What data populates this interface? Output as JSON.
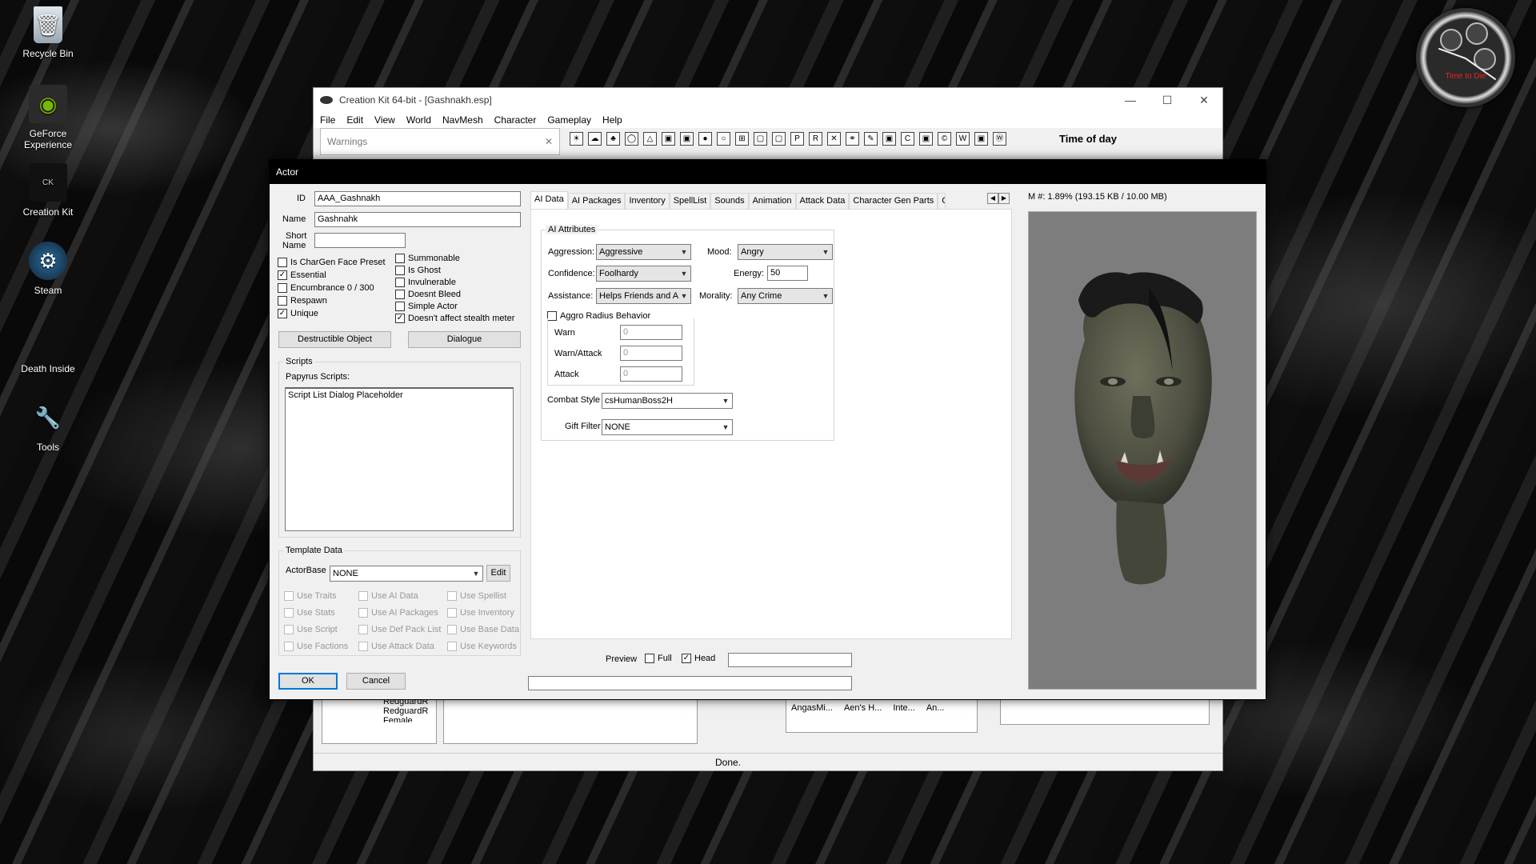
{
  "desktop": {
    "icons": [
      {
        "label": "Recycle Bin",
        "icon": "recycle-bin-icon"
      },
      {
        "label": "GeForce Experience",
        "icon": "geforce-icon"
      },
      {
        "label": "Creation Kit",
        "icon": "creation-kit-icon"
      },
      {
        "label": "Steam",
        "icon": "steam-icon"
      },
      {
        "label": "Death Inside",
        "icon": "folder-icon"
      },
      {
        "label": "Tools",
        "icon": "tools-icon"
      }
    ],
    "clock_label": "Time to Die"
  },
  "main_window": {
    "title": "Creation Kit 64-bit - [Gashnakh.esp]",
    "menu": [
      "File",
      "Edit",
      "View",
      "World",
      "NavMesh",
      "Character",
      "Gameplay",
      "Help"
    ],
    "toolbar_time_label": "Time of day",
    "warnings_title": "Warnings",
    "status": "Done.",
    "tree_items": [
      "RedguardR",
      "RedguardR",
      "Female"
    ],
    "list_columns": [
      "AngasMi...",
      "Aen's H...",
      "Inte...",
      "An..."
    ]
  },
  "actor_dialog": {
    "title": "Actor",
    "id_label": "ID",
    "id_value": "AAA_Gashnakh",
    "name_label": "Name",
    "name_value": "Gashnahk",
    "short_name_label_1": "Short",
    "short_name_label_2": "Name",
    "short_name_value": "",
    "flags_left": [
      {
        "label": "Is CharGen Face Preset",
        "checked": false
      },
      {
        "label": "Essential",
        "checked": true
      },
      {
        "label": "Encumbrance 0 / 300",
        "checked": false
      },
      {
        "label": "Respawn",
        "checked": false
      },
      {
        "label": "Unique",
        "checked": true
      }
    ],
    "flags_right": [
      {
        "label": "Summonable",
        "checked": false
      },
      {
        "label": "Is Ghost",
        "checked": false
      },
      {
        "label": "Invulnerable",
        "checked": false
      },
      {
        "label": "Doesnt Bleed",
        "checked": false
      },
      {
        "label": "Simple Actor",
        "checked": false
      },
      {
        "label": "Doesn't affect stealth meter",
        "checked": true
      }
    ],
    "destructible_button": "Destructible Object",
    "dialogue_button": "Dialogue",
    "scripts_group": "Scripts",
    "papyrus_label": "Papyrus Scripts:",
    "script_list_placeholder": "Script List Dialog Placeholder",
    "template_group": "Template Data",
    "actorbase_label": "ActorBase",
    "actorbase_value": "NONE",
    "edit_button": "Edit",
    "template_flags": [
      [
        "Use Traits",
        "Use AI Data",
        "Use Spellist"
      ],
      [
        "Use Stats",
        "Use AI Packages",
        "Use Inventory"
      ],
      [
        "Use Script",
        "Use Def Pack List",
        "Use Base Data"
      ],
      [
        "Use Factions",
        "Use Attack Data",
        "Use Keywords"
      ]
    ],
    "ok_button": "OK",
    "cancel_button": "Cancel",
    "tabs": [
      "AI Data",
      "AI Packages",
      "Inventory",
      "SpellList",
      "Sounds",
      "Animation",
      "Attack Data",
      "Character Gen Parts",
      "Character G"
    ],
    "active_tab": "AI Data",
    "ai_data": {
      "group": "AI Attributes",
      "aggression_label": "Aggression:",
      "aggression_value": "Aggressive",
      "mood_label": "Mood:",
      "mood_value": "Angry",
      "confidence_label": "Confidence:",
      "confidence_value": "Foolhardy",
      "energy_label": "Energy:",
      "energy_value": "50",
      "assistance_label": "Assistance:",
      "assistance_value": "Helps Friends and A",
      "morality_label": "Morality:",
      "morality_value": "Any Crime",
      "aggro_radius_label": "Aggro Radius Behavior",
      "warn_label": "Warn",
      "warn_value": "0",
      "warn_attack_label": "Warn/Attack",
      "warn_attack_value": "0",
      "attack_label": "Attack",
      "attack_value": "0",
      "combat_style_label": "Combat Style",
      "combat_style_value": "csHumanBoss2H",
      "gift_filter_label": "Gift Filter",
      "gift_filter_value": "NONE"
    },
    "memory_readout": "M #: 1.89% (193.15 KB / 10.00 MB)",
    "preview_label": "Preview",
    "preview_full_label": "Full",
    "preview_full_checked": false,
    "preview_head_label": "Head",
    "preview_head_checked": true
  }
}
